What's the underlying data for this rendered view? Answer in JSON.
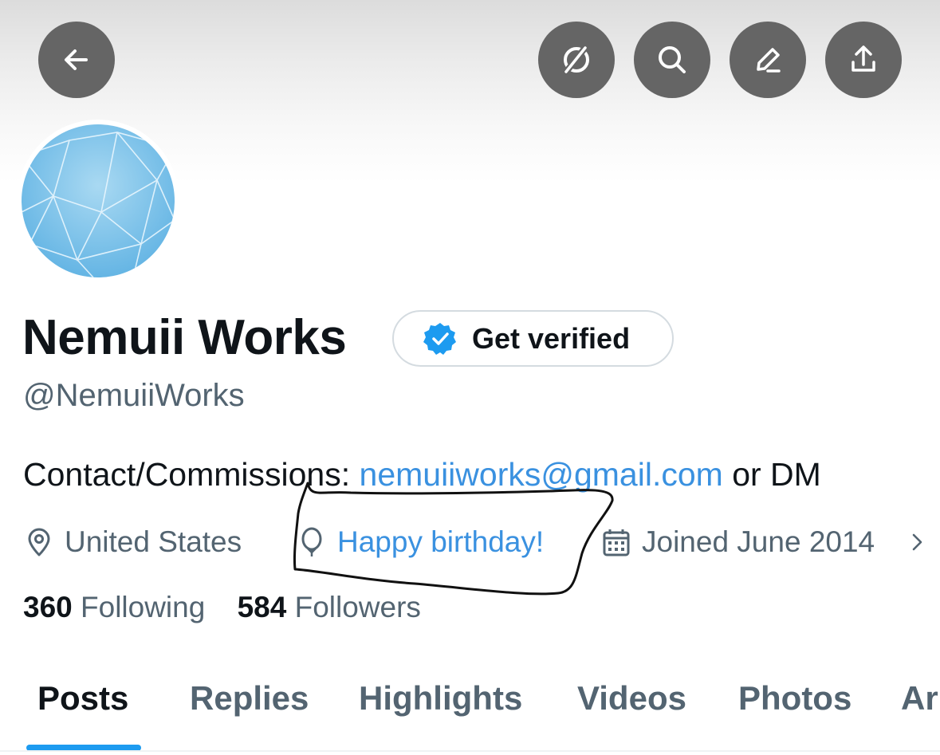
{
  "header": {
    "buttons": [
      {
        "name": "back-button",
        "icon": "arrow-left-icon"
      },
      {
        "name": "grok-button",
        "icon": "grok-icon"
      },
      {
        "name": "search-button",
        "icon": "search-icon"
      },
      {
        "name": "edit-button",
        "icon": "pencil-icon"
      },
      {
        "name": "share-button",
        "icon": "share-icon"
      }
    ]
  },
  "profile": {
    "display_name": "Nemuii Works",
    "verify_label": "Get verified",
    "handle": "@NemuiiWorks",
    "bio_prefix": "Contact/Commissions: ",
    "bio_email": "nemuiiworks@gmail.com",
    "bio_suffix": " or DM",
    "location": "United States",
    "birthday": "Happy birthday!",
    "joined": "Joined June 2014",
    "following_count": "360",
    "following_label": "Following",
    "followers_count": "584",
    "followers_label": "Followers"
  },
  "tabs": [
    {
      "label": "Posts",
      "active": true
    },
    {
      "label": "Replies",
      "active": false
    },
    {
      "label": "Highlights",
      "active": false
    },
    {
      "label": "Videos",
      "active": false
    },
    {
      "label": "Photos",
      "active": false
    },
    {
      "label": "Ar",
      "active": false
    }
  ],
  "colors": {
    "link": "#3a91e0",
    "accent": "#1d9bf0",
    "secondary_text": "#536471",
    "button_bg": "#656565"
  }
}
